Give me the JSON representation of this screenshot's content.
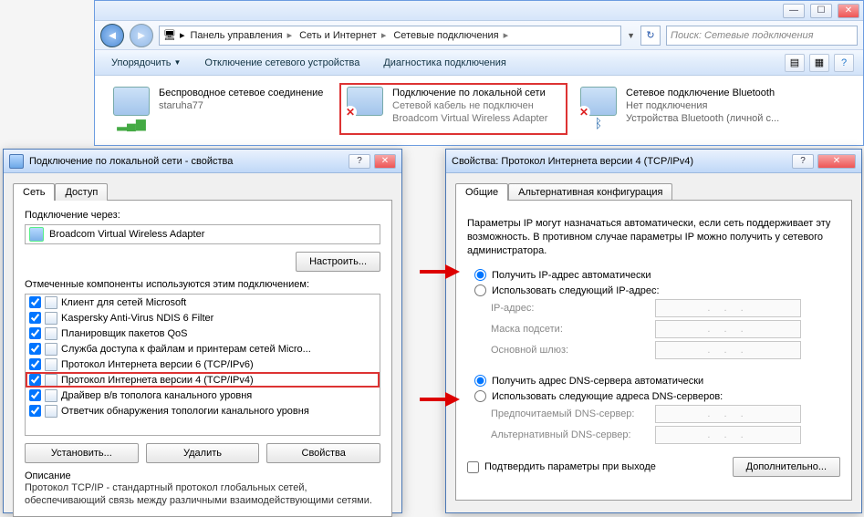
{
  "explorer": {
    "breadcrumbs": [
      "Панель управления",
      "Сеть и Интернет",
      "Сетевые подключения"
    ],
    "search_placeholder": "Поиск: Сетевые подключения",
    "cmd": {
      "organize": "Упорядочить",
      "disable": "Отключение сетевого устройства",
      "diag": "Диагностика подключения"
    },
    "conns": [
      {
        "title": "Беспроводное сетевое соединение",
        "sub": "staruha77",
        "dev": ""
      },
      {
        "title": "Подключение по локальной сети",
        "sub": "Сетевой кабель не подключен",
        "dev": "Broadcom Virtual Wireless Adapter"
      },
      {
        "title": "Сетевое подключение Bluetooth",
        "sub": "Нет подключения",
        "dev": "Устройства Bluetooth (личной с..."
      }
    ]
  },
  "props": {
    "title": "Подключение по локальной сети - свойства",
    "tabs": {
      "net": "Сеть",
      "share": "Доступ"
    },
    "conn_via": "Подключение через:",
    "adapter": "Broadcom Virtual Wireless Adapter",
    "configure": "Настроить...",
    "components_lbl": "Отмеченные компоненты используются этим подключением:",
    "items": [
      "Клиент для сетей Microsoft",
      "Kaspersky Anti-Virus NDIS 6 Filter",
      "Планировщик пакетов QoS",
      "Служба доступа к файлам и принтерам сетей Micro...",
      "Протокол Интернета версии 6 (TCP/IPv6)",
      "Протокол Интернета версии 4 (TCP/IPv4)",
      "Драйвер в/в тополога канального уровня",
      "Ответчик обнаружения топологии канального уровня"
    ],
    "install": "Установить...",
    "remove": "Удалить",
    "properties": "Свойства",
    "desc_lbl": "Описание",
    "desc": "Протокол TCP/IP - стандартный протокол глобальных сетей, обеспечивающий связь между различными взаимодействующими сетями."
  },
  "ipv4": {
    "title": "Свойства: Протокол Интернета версии 4 (TCP/IPv4)",
    "tabs": {
      "general": "Общие",
      "alt": "Альтернативная конфигурация"
    },
    "info": "Параметры IP могут назначаться автоматически, если сеть поддерживает эту возможность. В противном случае параметры IP можно получить у сетевого администратора.",
    "auto_ip": "Получить IP-адрес автоматически",
    "manual_ip": "Использовать следующий IP-адрес:",
    "ip_addr": "IP-адрес:",
    "mask": "Маска подсети:",
    "gw": "Основной шлюз:",
    "auto_dns": "Получить адрес DNS-сервера автоматически",
    "manual_dns": "Использовать следующие адреса DNS-серверов:",
    "pref_dns": "Предпочитаемый DNS-сервер:",
    "alt_dns": "Альтернативный DNS-сервер:",
    "validate": "Подтвердить параметры при выходе",
    "advanced": "Дополнительно...",
    "dots": ".   .   ."
  }
}
